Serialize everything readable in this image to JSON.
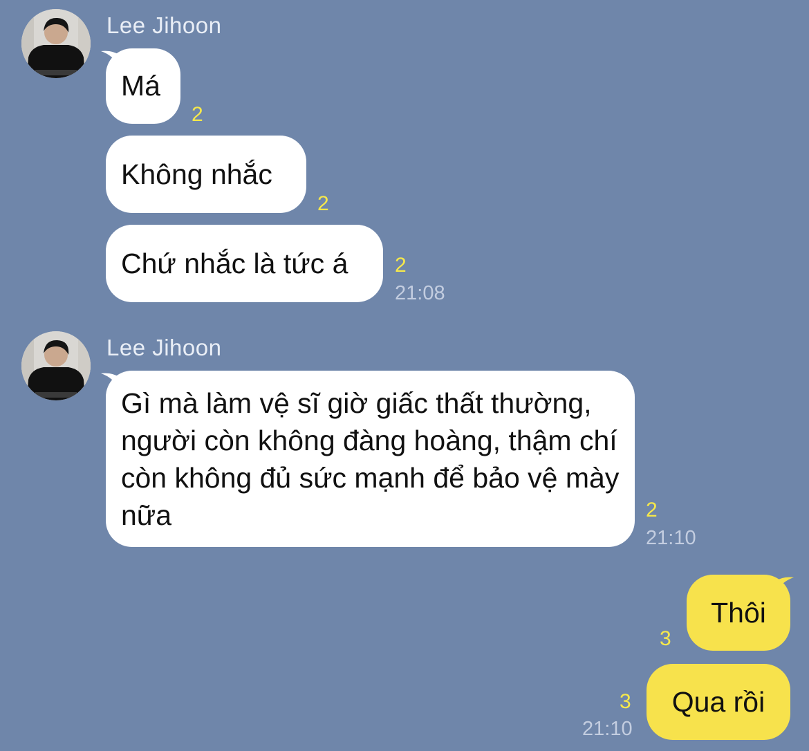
{
  "groups": [
    {
      "sender": "Lee Jihoon",
      "messages": [
        {
          "text": "Má",
          "unread": "2"
        },
        {
          "text": "Không nhắc",
          "unread": "2"
        },
        {
          "text": "Chứ nhắc là tức á",
          "unread": "2",
          "time": "21:08"
        }
      ]
    },
    {
      "sender": "Lee Jihoon",
      "messages": [
        {
          "text": "Gì mà làm vệ sĩ giờ giấc thất thường, người còn không đàng hoàng, thậm chí còn không đủ sức mạnh để bảo vệ mày nữa",
          "unread": "2",
          "time": "21:10"
        }
      ]
    }
  ],
  "outgoing": [
    {
      "text": "Thôi",
      "unread": "3"
    },
    {
      "text": "Qua rồi",
      "unread": "3",
      "time": "21:10"
    }
  ],
  "colors": {
    "background": "#6f86aa",
    "incoming_bubble": "#ffffff",
    "outgoing_bubble": "#f7e24c",
    "unread_count": "#f6e84b",
    "timestamp": "#c3cde0"
  }
}
